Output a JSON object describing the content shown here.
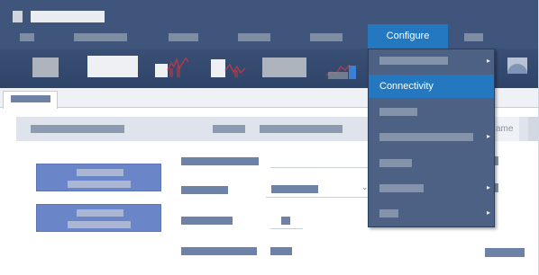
{
  "menubar": {
    "configure_label": "Configure"
  },
  "configure_menu": {
    "highlighted_item": "Connectivity"
  },
  "grid_header": {
    "partial_column_text": "ame"
  },
  "colors": {
    "chrome": "#3f557c",
    "accent": "#2478c0",
    "button": "#6a86c8"
  }
}
